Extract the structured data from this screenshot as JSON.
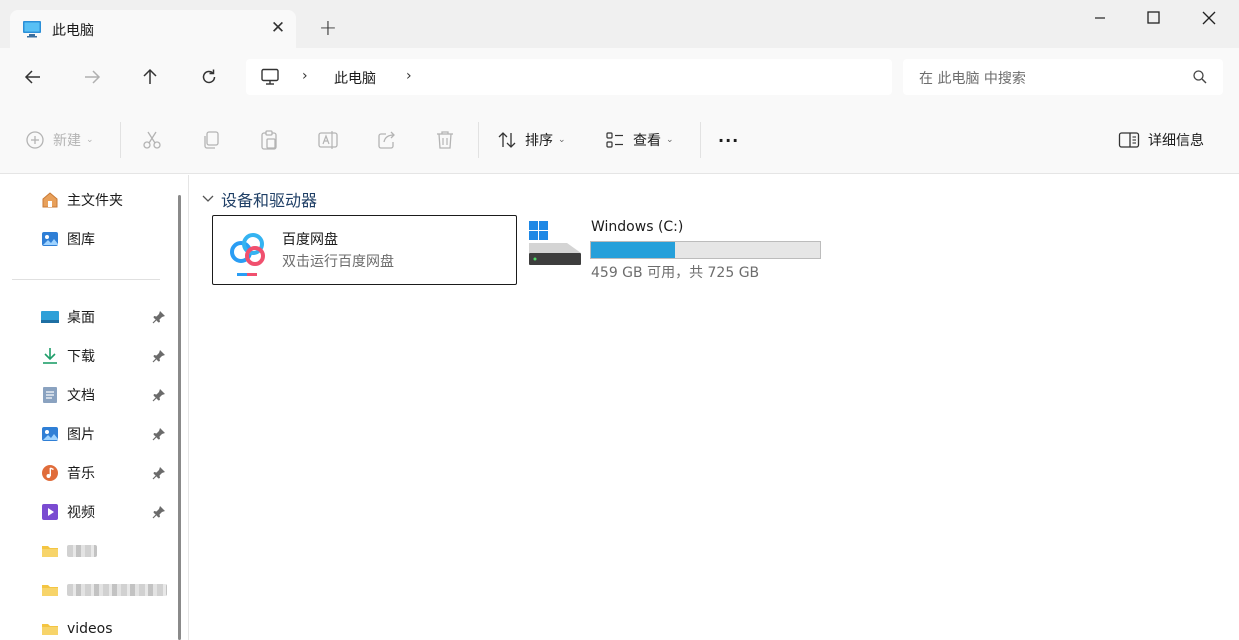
{
  "window": {
    "tab_title": "此电脑",
    "tab_close": "✕",
    "new_tab": "+"
  },
  "address": {
    "crumb": "此电脑",
    "separator": "›",
    "search_placeholder": "在 此电脑 中搜索"
  },
  "toolbar": {
    "new_label": "新建",
    "sort_label": "排序",
    "view_label": "查看",
    "more_label": "···",
    "details_label": "详细信息"
  },
  "sidebar": {
    "items": [
      {
        "label": "主文件夹",
        "icon": "home-icon",
        "pinned": false
      },
      {
        "label": "图库",
        "icon": "gallery-icon",
        "pinned": false
      },
      {
        "label": "桌面",
        "icon": "desktop-icon",
        "pinned": true
      },
      {
        "label": "下载",
        "icon": "download-icon",
        "pinned": true
      },
      {
        "label": "文档",
        "icon": "documents-icon",
        "pinned": true
      },
      {
        "label": "图片",
        "icon": "pictures-icon",
        "pinned": true
      },
      {
        "label": "音乐",
        "icon": "music-icon",
        "pinned": true
      },
      {
        "label": "视频",
        "icon": "videos-icon",
        "pinned": true
      },
      {
        "label": "",
        "icon": "folder-icon",
        "pinned": false,
        "blurred": true
      },
      {
        "label": "",
        "icon": "folder-icon",
        "pinned": false,
        "blurred": true
      },
      {
        "label": "videos",
        "icon": "folder-icon",
        "pinned": false
      }
    ]
  },
  "main": {
    "group_title": "设备和驱动器",
    "baidu": {
      "name": "百度网盘",
      "description": "双击运行百度网盘"
    },
    "drive": {
      "name": "Windows (C:)",
      "space_text": "459 GB 可用，共 725 GB",
      "used_fraction": 0.367
    }
  },
  "colors": {
    "accent": "#26a0da",
    "group_title": "#1f3f66",
    "folder": "#f4c542"
  }
}
